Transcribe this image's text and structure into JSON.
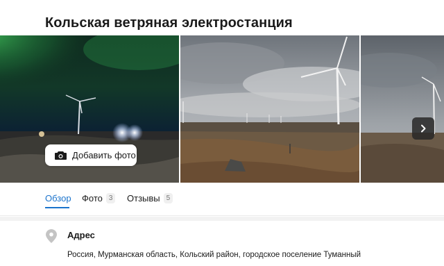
{
  "header": {
    "title": "Кольская ветряная электростанция"
  },
  "gallery": {
    "add_photo_label": "Добавить фото",
    "icons": {
      "camera": "camera-icon",
      "next": "chevron-right-icon"
    }
  },
  "tabs": [
    {
      "label": "Обзор",
      "count": "",
      "active": true
    },
    {
      "label": "Фото",
      "count": "3",
      "active": false
    },
    {
      "label": "Отзывы",
      "count": "5",
      "active": false
    }
  ],
  "address": {
    "title": "Адрес",
    "text": "Россия, Мурманская область, Кольский район, городское поселение Туманный",
    "icon": "location-pin-icon"
  },
  "colors": {
    "accent": "#1a73cc"
  }
}
